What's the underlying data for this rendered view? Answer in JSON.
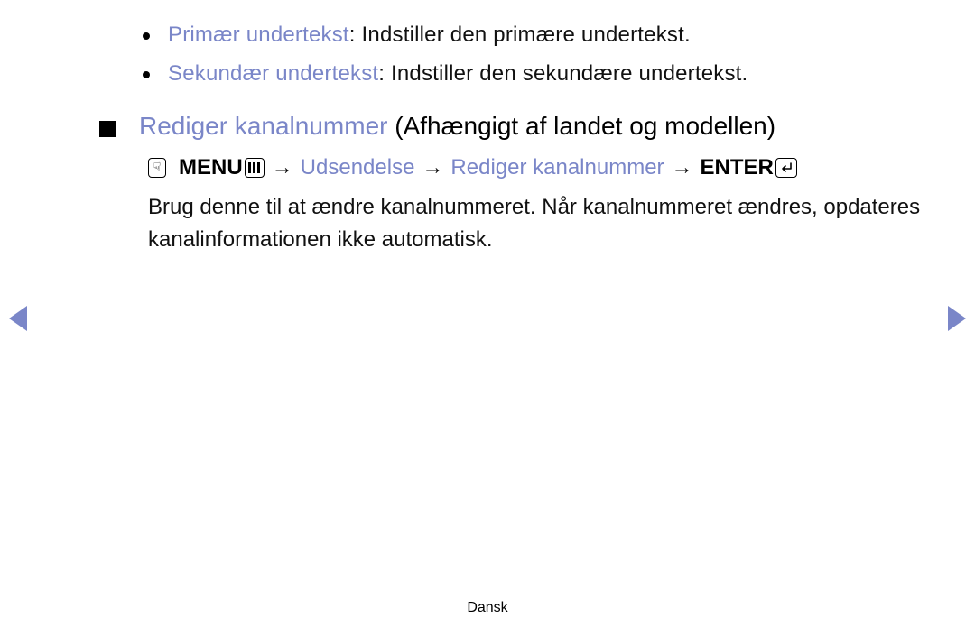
{
  "bullets": [
    {
      "term": "Primær undertekst",
      "desc": ": Indstiller den primære undertekst."
    },
    {
      "term": "Sekundær undertekst",
      "desc": ": Indstiller den sekundære undertekst."
    }
  ],
  "section": {
    "title_blue": "Rediger kanalnummer",
    "title_black": " (Afhængigt af landet og modellen)"
  },
  "nav": {
    "menu_label": "MENU",
    "path1": "Udsendelse",
    "path2": "Rediger kanalnummer",
    "enter_label": "ENTER",
    "arrow": "→"
  },
  "body": "Brug denne til at ændre kanalnummeret. Når kanalnummeret ændres, opdateres kanalinformationen ikke automatisk.",
  "footer": "Dansk",
  "icons": {
    "hand": "☟"
  }
}
